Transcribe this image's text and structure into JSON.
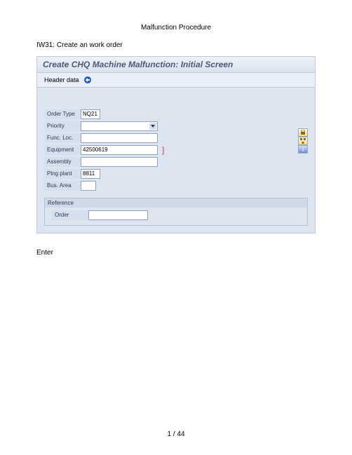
{
  "doc": {
    "title": "Malfunction Procedure",
    "subtitle": "IW31: Create an work order",
    "enter_text": "Enter",
    "page_number": "1 / 44"
  },
  "panel": {
    "title": "Create CHQ Machine Malfunction: Initial Screen",
    "toolbar_label": "Header data"
  },
  "form": {
    "order_type": {
      "label": "Order Type",
      "value": "NQ21"
    },
    "priority": {
      "label": "Priority",
      "value": ""
    },
    "func_loc": {
      "label": "Func. Loc.",
      "value": ""
    },
    "equipment": {
      "label": "Equipment",
      "value": "42500619"
    },
    "assembly": {
      "label": "Assembly",
      "value": ""
    },
    "plng_plant": {
      "label": "Plng plant",
      "value": "8811"
    },
    "bus_area": {
      "label": "Bus. Area",
      "value": ""
    }
  },
  "reference": {
    "header": "Reference",
    "order_label": "Order",
    "order_value": ""
  }
}
